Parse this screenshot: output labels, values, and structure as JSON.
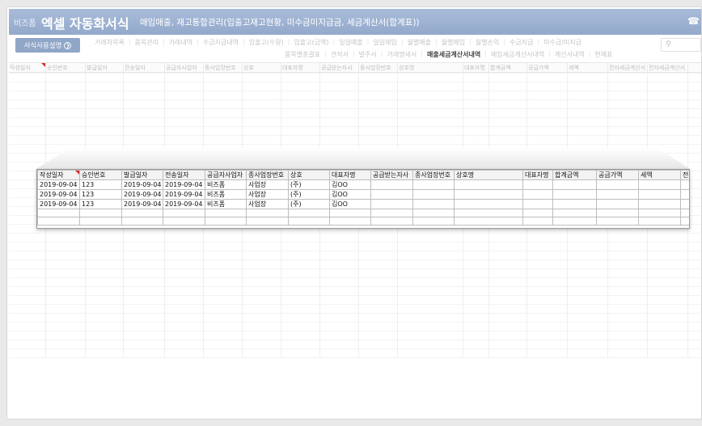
{
  "app": {
    "brand": "비즈폼",
    "title": "엑셀 자동화서식",
    "subtitle": "매입매출, 재고통합관리(입출고재고현황, 미수금미지급금, 세금계산서(합계표))",
    "phone_icon": "phone-icon"
  },
  "help_button": {
    "label": "서식사용설명",
    "icon": "arrow-right-circle-icon"
  },
  "search": {
    "placeholder": "",
    "icon": "search-icon"
  },
  "menu_row1": [
    "거래처목록",
    "품목관리",
    "거래내역",
    "수금지급내역",
    "입출고(수량)",
    "입출고(금액)",
    "일일매출",
    "일일매입",
    "월별매출",
    "월별매입",
    "월별손익",
    "수금지급",
    "미수금/미지급"
  ],
  "menu_row2": [
    "품목별총괄표",
    "견적서",
    "발주서",
    "거래명세서",
    "매출세금계산서내역",
    "매입세금계산서내역",
    "계산서내역",
    "현재표"
  ],
  "active_menu": "매출세금계산서내역",
  "bg_columns": [
    "작성일자",
    "승인번호",
    "발급일자",
    "전송일자",
    "공급자사업자",
    "종사업장번호",
    "상호",
    "대표자명",
    "공급받는자사",
    "종사업장번호",
    "상호명",
    "대표자명",
    "합계금액",
    "공급가액",
    "세액",
    "전자세금계산서",
    "전자세금계산서"
  ],
  "zoom_table": {
    "columns": [
      "작성일자",
      "승인번호",
      "발급일자",
      "전송일자",
      "공급자사업자",
      "종사업장번호",
      "상호",
      "대표자명",
      "공급받는자사",
      "종사업장번호",
      "상호명",
      "대표자명",
      "합계금액",
      "공급가액",
      "세액",
      "전"
    ],
    "rows": [
      [
        "2019-09-04",
        "123",
        "2019-09-04",
        "2019-09-04",
        "비즈폼",
        "사업장",
        "(주)",
        "김OO",
        "",
        "",
        "",
        "",
        "",
        "",
        "",
        ""
      ],
      [
        "2019-09-04",
        "123",
        "2019-09-04",
        "2019-09-04",
        "비즈폼",
        "사업장",
        "(주)",
        "김OO",
        "",
        "",
        "",
        "",
        "",
        "",
        "",
        ""
      ],
      [
        "2019-09-04",
        "123",
        "2019-09-04",
        "2019-09-04",
        "비즈폼",
        "사업장",
        "(주)",
        "김OO",
        "",
        "",
        "",
        "",
        "",
        "",
        "",
        ""
      ],
      [
        "",
        "",
        "",
        "",
        "",
        "",
        "",
        "",
        "",
        "",
        "",
        "",
        "",
        "",
        "",
        ""
      ],
      [
        "",
        "",
        "",
        "",
        "",
        "",
        "",
        "",
        "",
        "",
        "",
        "",
        "",
        "",
        "",
        ""
      ]
    ]
  },
  "colors": {
    "title_bar": "#9fb4d4",
    "comment_flag": "#d03030"
  }
}
